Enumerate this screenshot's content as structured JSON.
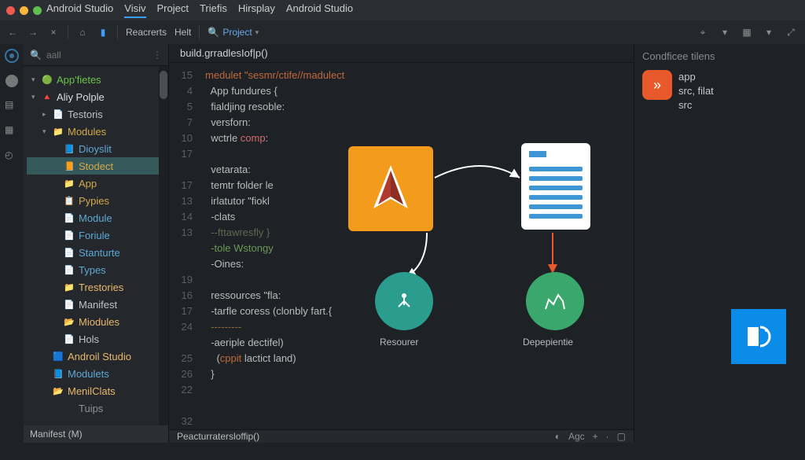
{
  "title_menu": [
    "Android Studio",
    "Visiv",
    "Project",
    "Triefis",
    "Hirsplay",
    "Android Studio"
  ],
  "title_active_index": 1,
  "toolbar": {
    "reacrerts": "Reacrerts",
    "helt": "Helt",
    "project": "Project"
  },
  "sidebar_search_placeholder": "aall",
  "tree": [
    {
      "d": 0,
      "exp": true,
      "icon": "🟢",
      "label": "App'fietes",
      "color": "#6cc24a"
    },
    {
      "d": 0,
      "exp": true,
      "icon": "🔺",
      "label": "Aliy Polple",
      "color": "#d9dde1"
    },
    {
      "d": 1,
      "exp": false,
      "icon": "📄",
      "label": "Testoris",
      "color": "#bfc4c9"
    },
    {
      "d": 1,
      "exp": true,
      "icon": "📁",
      "label": "Modules",
      "color": "#d4a94a"
    },
    {
      "d": 2,
      "icon": "📘",
      "label": "Dioyslit",
      "color": "#5fa8d3"
    },
    {
      "d": 2,
      "icon": "📙",
      "label": "Stodect",
      "color": "#d4a94a",
      "sel": true
    },
    {
      "d": 2,
      "icon": "📁",
      "label": "App",
      "color": "#d4a94a"
    },
    {
      "d": 2,
      "icon": "📋",
      "label": "Pypies",
      "color": "#d4a94a"
    },
    {
      "d": 2,
      "icon": "📄",
      "label": "Module",
      "color": "#5fa8d3"
    },
    {
      "d": 2,
      "icon": "📄",
      "label": "Foriule",
      "color": "#5fa8d3"
    },
    {
      "d": 2,
      "icon": "📄",
      "label": "Stanturte",
      "color": "#5fa8d3"
    },
    {
      "d": 2,
      "icon": "📄",
      "label": "Types",
      "color": "#5fa8d3"
    },
    {
      "d": 2,
      "icon": "📁",
      "label": "Trestories",
      "color": "#e8b86a"
    },
    {
      "d": 2,
      "icon": "📄",
      "label": "Manifest",
      "color": "#bfc4c9"
    },
    {
      "d": 2,
      "icon": "📂",
      "label": "Miodules",
      "color": "#e8b86a"
    },
    {
      "d": 2,
      "icon": "📄",
      "label": "Hols",
      "color": "#bfc4c9"
    },
    {
      "d": 1,
      "icon": "🟦",
      "label": "Androil Studio",
      "color": "#e8b86a"
    },
    {
      "d": 1,
      "icon": "📘",
      "label": "Modulets",
      "color": "#5fa8d3"
    },
    {
      "d": 1,
      "icon": "📂",
      "label": "MenilClats",
      "color": "#e8b86a"
    },
    {
      "d": 2,
      "icon": "",
      "label": "Tuips",
      "color": "#8b9196"
    }
  ],
  "sidebar_footer": "Manifest (M)",
  "tab_label": "build.grradlesIof|p()",
  "gutter": [
    "15",
    "4",
    "5",
    "7",
    "10",
    "17",
    "",
    "17",
    "13",
    "14",
    "13",
    "",
    "",
    "19",
    "16",
    "17",
    "24",
    "",
    "25",
    "26",
    "22",
    "",
    "32"
  ],
  "code_lines": [
    {
      "t": "medulet \"sesmr/ctife//madulect",
      "cls": "hl"
    },
    {
      "t": "  App fundures {",
      "cls": ""
    },
    {
      "t": "  fialdjing resoble:",
      "cls": ""
    },
    {
      "t": "  versforn:",
      "cls": ""
    },
    {
      "t": "  wctrle comp:",
      "cls": "",
      "mix": [
        {
          "t": "  wctrle ",
          "c": ""
        },
        {
          "t": "comp",
          "c": "err"
        },
        {
          "t": ":",
          "c": ""
        }
      ]
    },
    {
      "t": "",
      "cls": ""
    },
    {
      "t": "  vetarata:",
      "cls": ""
    },
    {
      "t": "  temtr folder le",
      "cls": ""
    },
    {
      "t": "  irlatutor \"fiokl",
      "cls": ""
    },
    {
      "t": "  -clats",
      "cls": ""
    },
    {
      "t": "  --fttawresfly }",
      "cls": "cmt"
    },
    {
      "t": "  -tole Wstongy",
      "cls": "str"
    },
    {
      "t": "  -Oines:",
      "cls": ""
    },
    {
      "t": "",
      "cls": ""
    },
    {
      "t": "  ressources \"fla:",
      "cls": ""
    },
    {
      "t": "  -tarfle coress (clonbly fart.{",
      "cls": ""
    },
    {
      "t": "  ---------",
      "cls": "dash"
    },
    {
      "t": "  -aeriple dectifel)",
      "cls": ""
    },
    {
      "t": "    (cppit lactict land)",
      "cls": "",
      "mix": [
        {
          "t": "    (",
          "c": ""
        },
        {
          "t": "cppit",
          "c": "hl"
        },
        {
          "t": " lactict land)",
          "c": ""
        }
      ]
    },
    {
      "t": "  }",
      "cls": ""
    },
    {
      "t": "",
      "cls": ""
    },
    {
      "t": "",
      "cls": ""
    }
  ],
  "diagram": {
    "lbl1": "Resourer",
    "lbl2": "Depepientie"
  },
  "right_panel": {
    "title": "Condficee tilens",
    "items": [
      "app",
      "src, filat",
      "src"
    ]
  },
  "status": {
    "left": "Peacturratersloffip()",
    "agc": "Agc"
  }
}
